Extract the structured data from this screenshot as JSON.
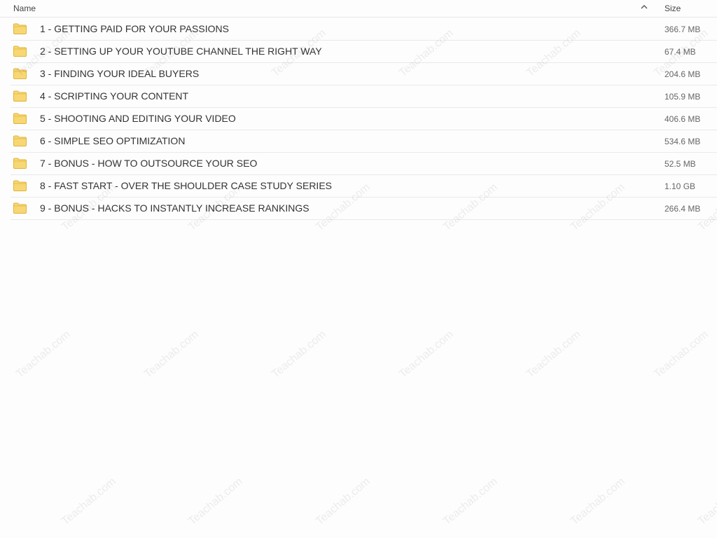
{
  "header": {
    "name_label": "Name",
    "size_label": "Size",
    "sort_icon": "chevron-up-icon"
  },
  "files": [
    {
      "name": "1 - GETTING PAID FOR YOUR PASSIONS",
      "size": "366.7 MB",
      "icon": "folder-icon"
    },
    {
      "name": "2 - SETTING UP YOUR YOUTUBE CHANNEL THE RIGHT WAY",
      "size": "67.4 MB",
      "icon": "folder-icon"
    },
    {
      "name": "3 - FINDING YOUR IDEAL BUYERS",
      "size": "204.6 MB",
      "icon": "folder-icon"
    },
    {
      "name": "4 - SCRIPTING YOUR CONTENT",
      "size": "105.9 MB",
      "icon": "folder-icon"
    },
    {
      "name": "5 - SHOOTING AND EDITING YOUR VIDEO",
      "size": "406.6 MB",
      "icon": "folder-icon"
    },
    {
      "name": "6 - SIMPLE SEO OPTIMIZATION",
      "size": "534.6 MB",
      "icon": "folder-icon"
    },
    {
      "name": "7 - BONUS - HOW TO OUTSOURCE YOUR SEO",
      "size": "52.5 MB",
      "icon": "folder-icon"
    },
    {
      "name": "8 - FAST START - OVER THE SHOULDER CASE STUDY SERIES",
      "size": "1.10 GB",
      "icon": "folder-icon"
    },
    {
      "name": "9 - BONUS - HACKS TO INSTANTLY INCREASE RANKINGS",
      "size": "266.4 MB",
      "icon": "folder-icon"
    }
  ],
  "watermark": "Teachab.com",
  "colors": {
    "folder_fill": "#f7d774",
    "folder_stroke": "#e2b33d"
  }
}
